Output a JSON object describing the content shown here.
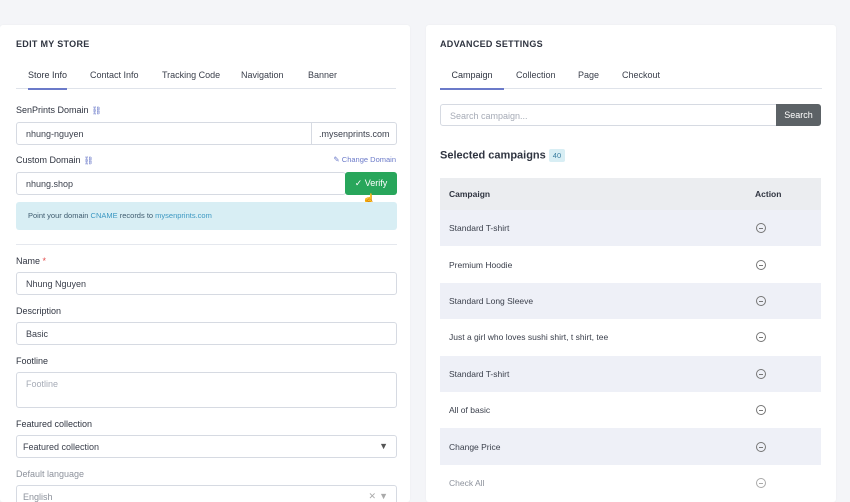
{
  "left": {
    "title": "EDIT MY STORE",
    "tabs": [
      "Store Info",
      "Contact Info",
      "Tracking Code",
      "Navigation",
      "Banner"
    ],
    "senprints_domain": {
      "label": "SenPrints Domain",
      "value": "nhung-nguyen",
      "suffix": ".mysenprints.com"
    },
    "custom_domain": {
      "label": "Custom Domain",
      "value": "nhung.shop",
      "change_label": "Change Domain",
      "verify_label": "Verify"
    },
    "info": {
      "prefix": "Point your domain ",
      "cname": "CNAME",
      "middle": " records to ",
      "target": "mysenprints.com"
    },
    "name": {
      "label": "Name",
      "required": "*",
      "value": "Nhung Nguyen"
    },
    "description": {
      "label": "Description",
      "value": "Basic"
    },
    "footline": {
      "label": "Footline",
      "placeholder": "Footline"
    },
    "featured": {
      "label": "Featured collection",
      "value": "Featured collection"
    },
    "language": {
      "label": "Default language",
      "value": "English"
    }
  },
  "right": {
    "title": "ADVANCED SETTINGS",
    "tabs": [
      "Campaign",
      "Collection",
      "Page",
      "Checkout"
    ],
    "search": {
      "placeholder": "Search campaign...",
      "button": "Search"
    },
    "selected": {
      "title": "Selected campaigns",
      "count": "40"
    },
    "table": {
      "headers": [
        "Campaign",
        "Action"
      ],
      "rows": [
        "Standard T-shirt",
        "Premium Hoodie",
        "Standard Long Sleeve",
        "Just a girl who loves sushi shirt, t shirt, tee",
        "Standard T-shirt",
        "All of basic",
        "Change Price",
        "Check All"
      ]
    }
  }
}
